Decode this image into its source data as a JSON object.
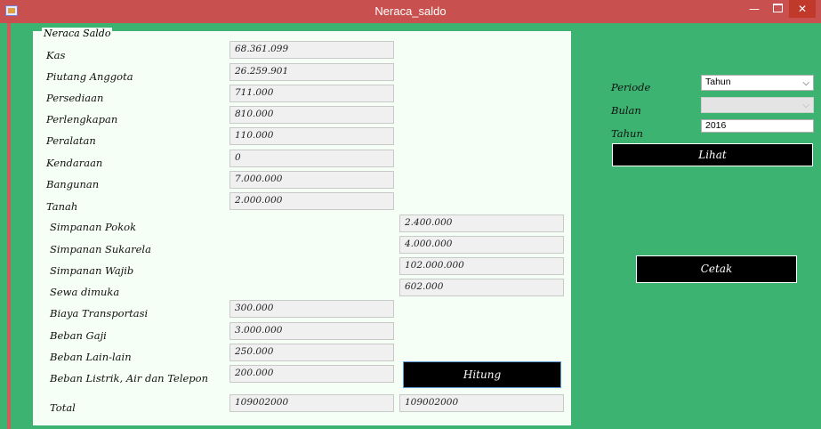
{
  "window": {
    "title": "Neraca_saldo",
    "minimize": "—",
    "close": "✕"
  },
  "group": {
    "title": "Neraca Saldo"
  },
  "rows": [
    {
      "label": "Kas",
      "value": "68.361.099"
    },
    {
      "label": "Piutang Anggota",
      "value": "26.259.901"
    },
    {
      "label": "Persediaan",
      "value": "711.000"
    },
    {
      "label": "Perlengkapan",
      "value": "810.000"
    },
    {
      "label": "Peralatan",
      "value": "110.000"
    },
    {
      "label": "Kendaraan",
      "value": "0"
    },
    {
      "label": "Bangunan",
      "value": "7.000.000"
    },
    {
      "label": "Tanah",
      "value": "2.000.000"
    },
    {
      "label": "Simpanan Pokok",
      "value": "2.400.000"
    },
    {
      "label": "Simpanan Sukarela",
      "value": "4.000.000"
    },
    {
      "label": "Simpanan Wajib",
      "value": "102.000.000"
    },
    {
      "label": "Sewa dimuka",
      "value": "602.000"
    },
    {
      "label": "Biaya Transportasi",
      "value": "300.000"
    },
    {
      "label": "Beban Gaji",
      "value": "3.000.000"
    },
    {
      "label": "Beban Lain-lain",
      "value": "250.000"
    },
    {
      "label": "Beban Listrik, Air dan Telepon",
      "value": "200.000"
    }
  ],
  "total": {
    "label": "Total",
    "debit": "109002000",
    "credit": "109002000"
  },
  "buttons": {
    "hitung": "Hitung",
    "lihat": "Lihat",
    "cetak": "Cetak"
  },
  "filter": {
    "periode_label": "Periode",
    "periode_value": "Tahun",
    "bulan_label": "Bulan",
    "bulan_value": "",
    "tahun_label": "Tahun",
    "tahun_value": "2016"
  }
}
